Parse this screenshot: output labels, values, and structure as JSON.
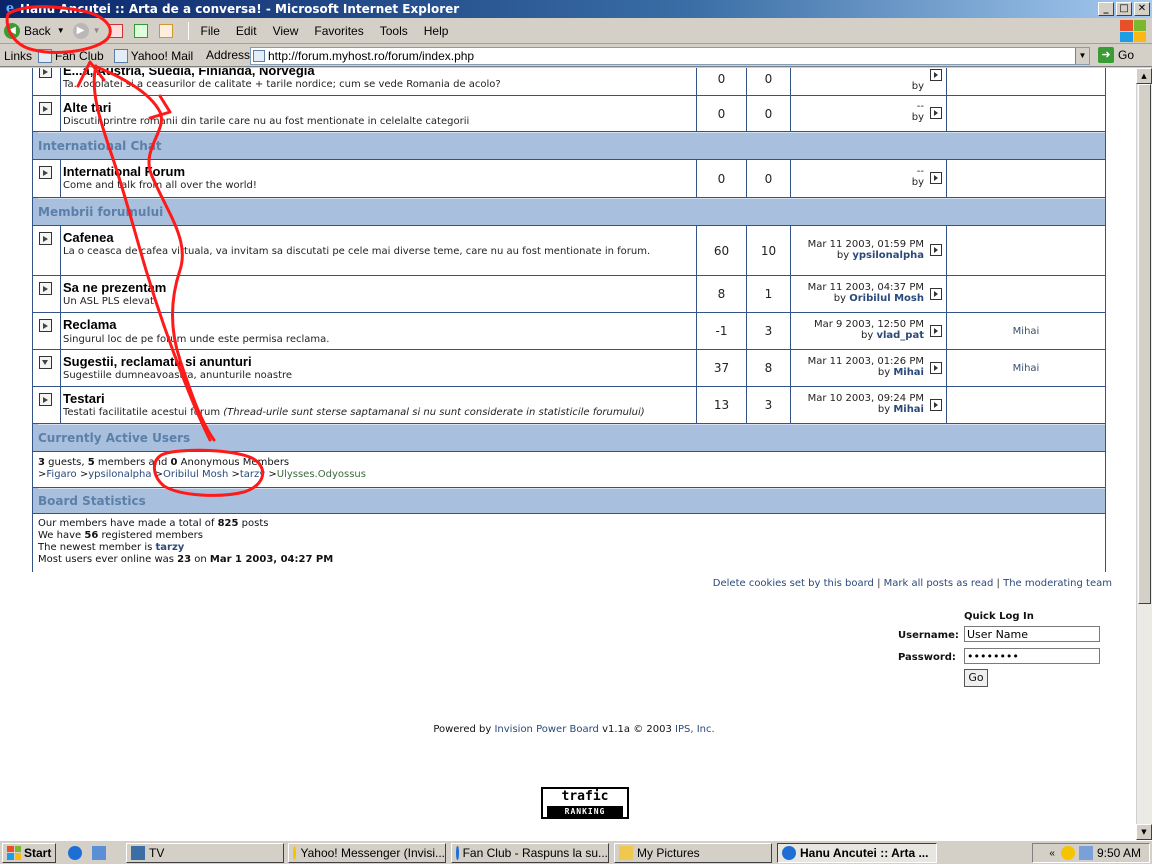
{
  "window": {
    "title": "Hanu Ancutei :: Arta de a conversa! - Microsoft Internet Explorer",
    "min": "_",
    "max": "□",
    "close": "✕"
  },
  "toolbar": {
    "back": "Back",
    "menu": [
      "File",
      "Edit",
      "View",
      "Favorites",
      "Tools",
      "Help"
    ]
  },
  "addressbar": {
    "links_label": "Links",
    "links": [
      "Fan Club",
      "Yahoo! Mail"
    ],
    "address_label": "Address",
    "url": "http://forum.myhost.ro/forum/index.php",
    "go": "Go"
  },
  "forums_top": [
    {
      "name": "E...a, Austria, Suedia, Finlanda, Norvegia",
      "desc": "Ta...ocolatei si a ceasurilor de calitate + tarile nordice; cum se vede Romania de acolo?",
      "topics": "0",
      "posts": "0",
      "last_date": "",
      "last_by": "by",
      "last_user": "",
      "mod": "",
      "icon": "right"
    },
    {
      "name": "Alte tari",
      "desc": "Discutii printre romanii din tarile care nu au fost mentionate in celelalte categorii",
      "topics": "0",
      "posts": "0",
      "last_date": "--",
      "last_by": "by",
      "last_user": "",
      "mod": "",
      "icon": "right"
    }
  ],
  "cat_international": "International Chat",
  "forum_international": {
    "name": "International Forum",
    "desc": "Come and talk from all over the world!",
    "topics": "0",
    "posts": "0",
    "last_date": "--",
    "last_by": "by",
    "last_user": "",
    "mod": ""
  },
  "cat_members": "Membrii forumului",
  "forums_members": [
    {
      "name": "Cafenea",
      "desc": "La o ceasca de cafea virtuala, va invitam sa discutati pe cele mai diverse teme, care nu au fost mentionate in forum.",
      "topics": "60",
      "posts": "10",
      "last_date": "Mar 11 2003, 01:59 PM",
      "last_by": "by",
      "last_user": "ypsilonalpha",
      "mod": "",
      "icon": "right"
    },
    {
      "name": "Sa ne prezentam",
      "desc": "Un ASL PLS elevat",
      "topics": "8",
      "posts": "1",
      "last_date": "Mar 11 2003, 04:37 PM",
      "last_by": "by",
      "last_user": "Oribilul Mosh",
      "mod": "",
      "icon": "right"
    },
    {
      "name": "Reclama",
      "desc": "Singurul loc de pe forum unde este permisa reclama.",
      "topics": "-1",
      "posts": "3",
      "last_date": "Mar 9 2003, 12:50 PM",
      "last_by": "by",
      "last_user": "vlad_pat",
      "mod": "Mihai",
      "icon": "right"
    },
    {
      "name": "Sugestii, reclamatii si anunturi",
      "desc": "Sugestiile dumneavoastra, anunturile noastre",
      "topics": "37",
      "posts": "8",
      "last_date": "Mar 11 2003, 01:26 PM",
      "last_by": "by",
      "last_user": "Mihai",
      "mod": "Mihai",
      "icon": "down"
    },
    {
      "name": "Testari",
      "desc": "Testati facilitatile acestui forum",
      "desc_italic": "(Thread-urile sunt sterse saptamanal si nu sunt considerate in statisticile forumului)",
      "topics": "13",
      "posts": "3",
      "last_date": "Mar 10 2003, 09:24 PM",
      "last_by": "by",
      "last_user": "Mihai",
      "mod": "",
      "icon": "right"
    }
  ],
  "cat_active": "Currently Active Users",
  "active": {
    "guests": "3",
    "guests_label": "guests,",
    "members": "5",
    "members_label": "members and",
    "anon": "0",
    "anon_label": "Anonymous Members",
    "users": [
      "Figaro",
      "ypsilonalpha",
      "Oribilul Mosh",
      "tarzy",
      "Ulysses.Odyossus"
    ]
  },
  "cat_stats": "Board Statistics",
  "stats": {
    "posts_pre": "Our members have made a total of",
    "posts_count": "825",
    "posts_post": "posts",
    "reg_pre": "We have",
    "reg_count": "56",
    "reg_post": "registered members",
    "newest_pre": "The newest member is",
    "newest_user": "tarzy",
    "online_pre": "Most users ever online was",
    "online_count": "23",
    "online_on": "on",
    "online_date": "Mar 1 2003, 04:27 PM"
  },
  "footer_links": [
    "Delete cookies set by this board",
    "Mark all posts as read",
    "The moderating team"
  ],
  "login": {
    "title": "Quick Log In",
    "username_label": "Username:",
    "username_value": "User Name",
    "password_label": "Password:",
    "password_value": "••••••••",
    "go": "Go"
  },
  "powered": {
    "pre": "Powered by",
    "ipb": "Invision Power Board",
    "ver": "v1.1a © 2003",
    "ips": "IPS, Inc."
  },
  "trafic": {
    "line1": "trafic",
    "line2": "RANKING"
  },
  "taskbar": {
    "start": "Start",
    "tasks": [
      "TV",
      "Yahoo! Messenger (Invisi...",
      "Fan Club - Raspuns la su...",
      "My Pictures",
      "Hanu Ancutei :: Arta ..."
    ],
    "clock": "9:50 AM"
  },
  "colors": {
    "annotation": "#ff1a1a",
    "category_bg": "#a8c0de",
    "link": "#2a4a7a"
  }
}
